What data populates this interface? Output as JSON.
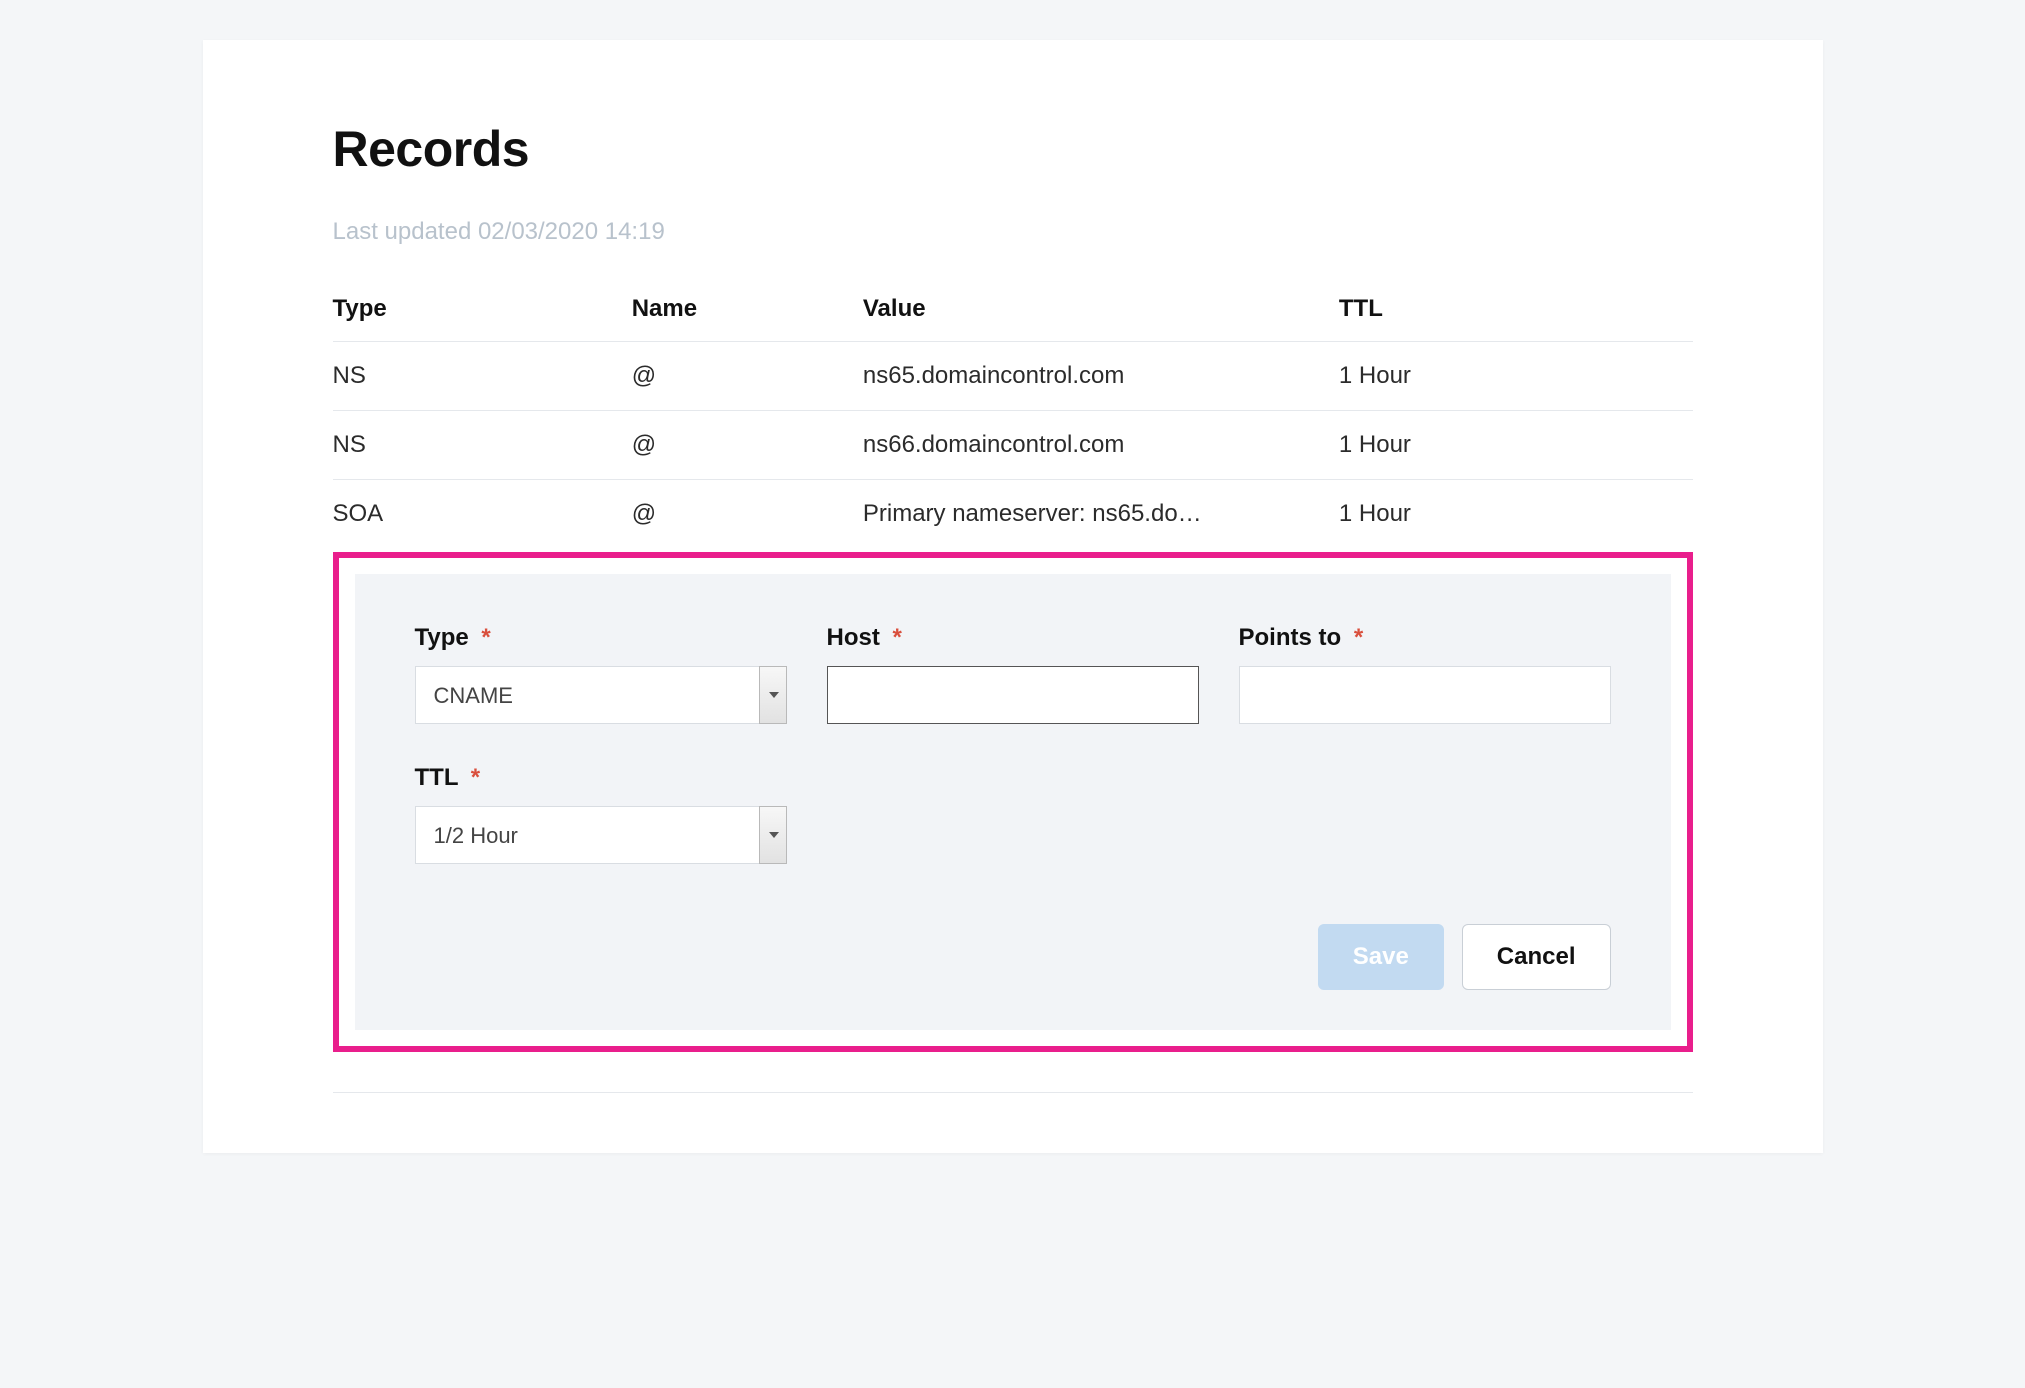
{
  "title": "Records",
  "last_updated": "Last updated 02/03/2020 14:19",
  "table": {
    "headers": {
      "type": "Type",
      "name": "Name",
      "value": "Value",
      "ttl": "TTL"
    },
    "rows": [
      {
        "type": "NS",
        "name": "@",
        "value": "ns65.domaincontrol.com",
        "ttl": "1 Hour"
      },
      {
        "type": "NS",
        "name": "@",
        "value": "ns66.domaincontrol.com",
        "ttl": "1 Hour"
      },
      {
        "type": "SOA",
        "name": "@",
        "value": "Primary nameserver: ns65.do…",
        "ttl": "1 Hour"
      }
    ]
  },
  "form": {
    "labels": {
      "type": "Type",
      "host": "Host",
      "points_to": "Points to",
      "ttl": "TTL"
    },
    "required_mark": "*",
    "values": {
      "type": "CNAME",
      "host": "",
      "points_to": "",
      "ttl": "1/2 Hour"
    },
    "buttons": {
      "save": "Save",
      "cancel": "Cancel"
    }
  }
}
